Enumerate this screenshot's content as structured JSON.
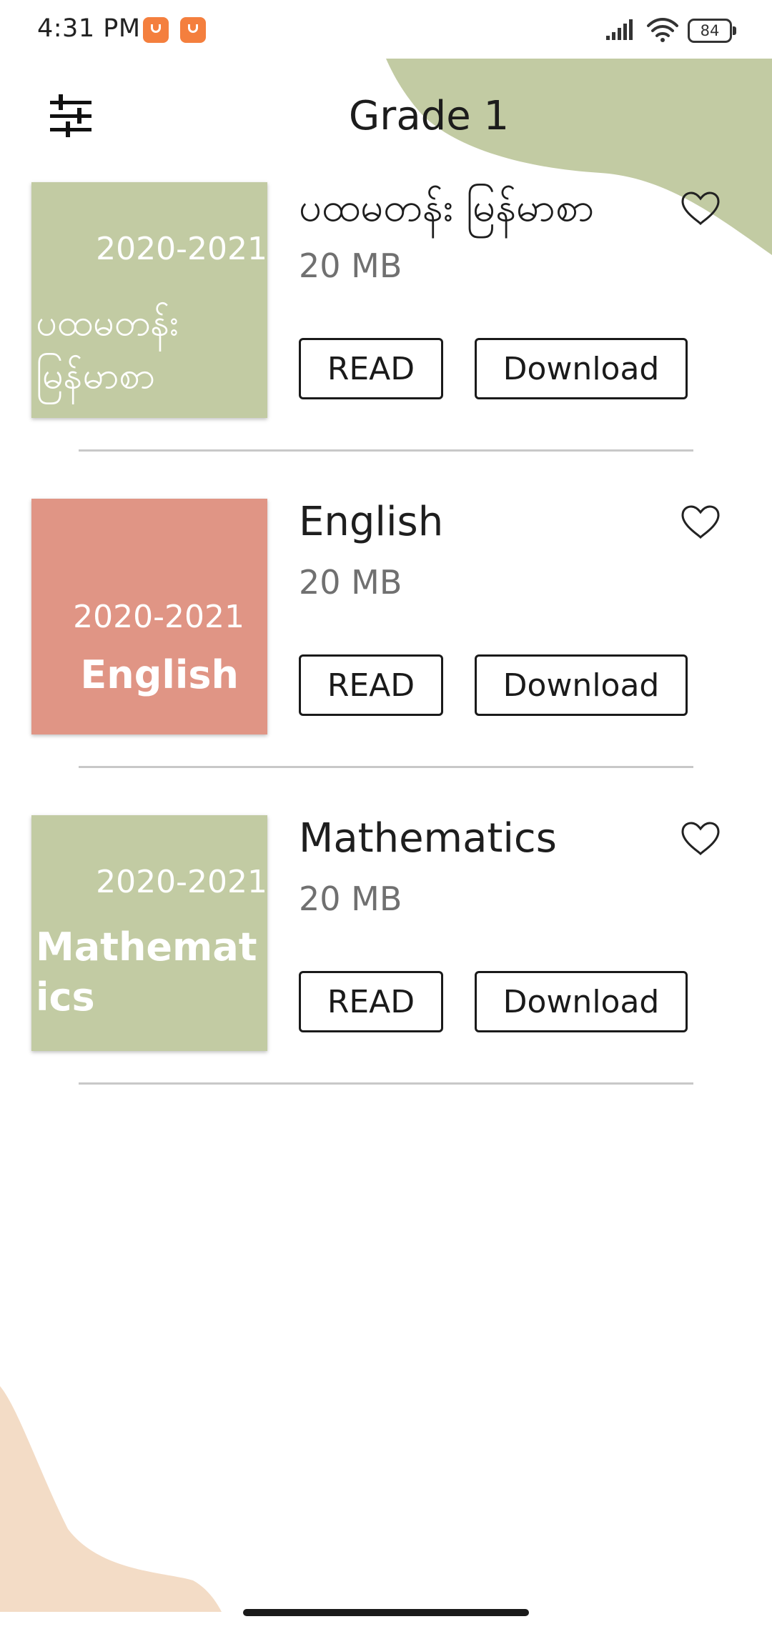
{
  "status_bar": {
    "time": "4:31 PM",
    "battery": "84"
  },
  "header": {
    "title": "Grade 1"
  },
  "books": [
    {
      "cover_year": "2020-2021",
      "cover_title": "ပထမတန်း မြန်မာစာ",
      "cover_color": "#c2cba3",
      "title": "ပထမတန်း မြန်မာစာ",
      "size": "20 MB",
      "read_label": "READ",
      "download_label": "Download"
    },
    {
      "cover_year": "2020-2021",
      "cover_title": "English",
      "cover_color": "#e09585",
      "title": "English",
      "size": "20 MB",
      "read_label": "READ",
      "download_label": "Download"
    },
    {
      "cover_year": "2020-2021",
      "cover_title": "Mathematics",
      "cover_color": "#c2cba3",
      "title": "Mathematics",
      "size": "20 MB",
      "read_label": "READ",
      "download_label": "Download"
    }
  ],
  "colors": {
    "top_blob": "#c2cba3",
    "bottom_blob": "#f3dcc6"
  },
  "icons": {
    "filter": "sliders-icon",
    "favorite": "heart-outline-icon"
  }
}
